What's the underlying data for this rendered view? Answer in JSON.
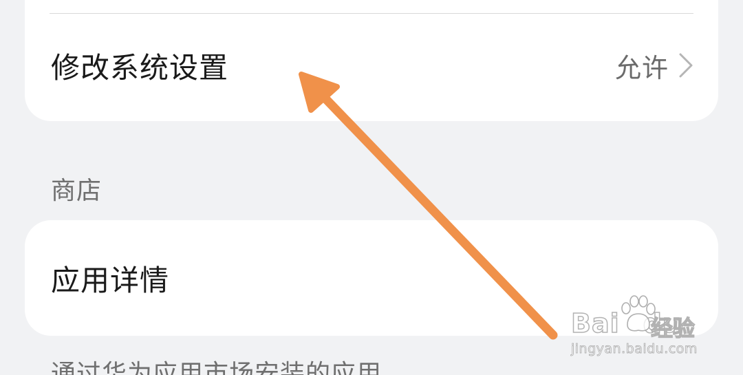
{
  "permissions": {
    "modify_system_settings": {
      "label": "修改系统设置",
      "value": "允许",
      "icon": "chevron-right-icon"
    }
  },
  "store_section": {
    "title": "商店",
    "app_details_label": "应用详情",
    "footnote": "通过华为应用市场安装的应用"
  },
  "annotation": {
    "arrow_color": "#f0914a"
  },
  "watermark": {
    "brand": "Bai",
    "brand_suffix": "du",
    "product": "经验",
    "url": "jingyan.baidu.com"
  }
}
